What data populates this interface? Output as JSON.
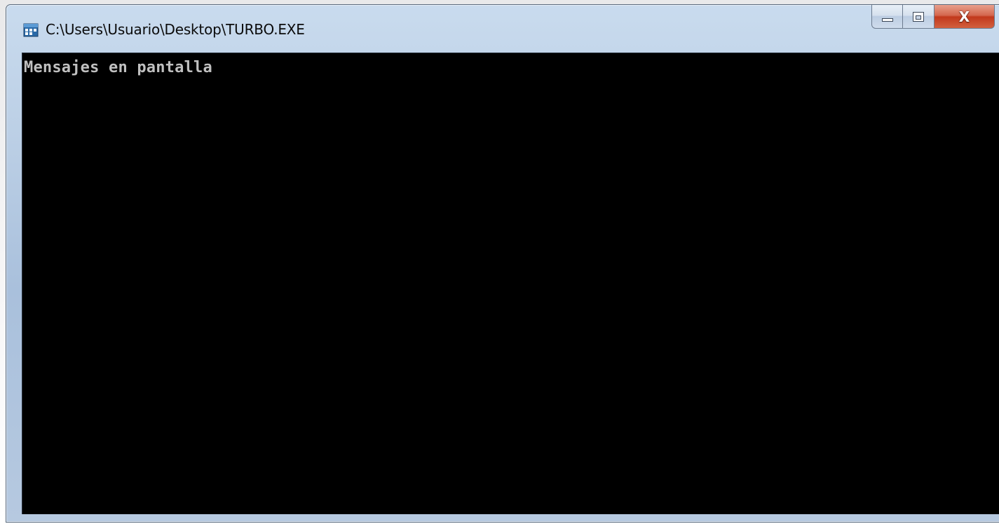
{
  "window": {
    "title": "C:\\Users\\Usuario\\Desktop\\TURBO.EXE",
    "icon": "console-app-icon",
    "close_label": "X",
    "colors": {
      "frame": "#b9cde4",
      "close": "#c2391c",
      "console_bg": "#000000",
      "console_text": "#c0c0c0"
    }
  },
  "console": {
    "lines": [
      "Mensajes en pantalla"
    ]
  }
}
